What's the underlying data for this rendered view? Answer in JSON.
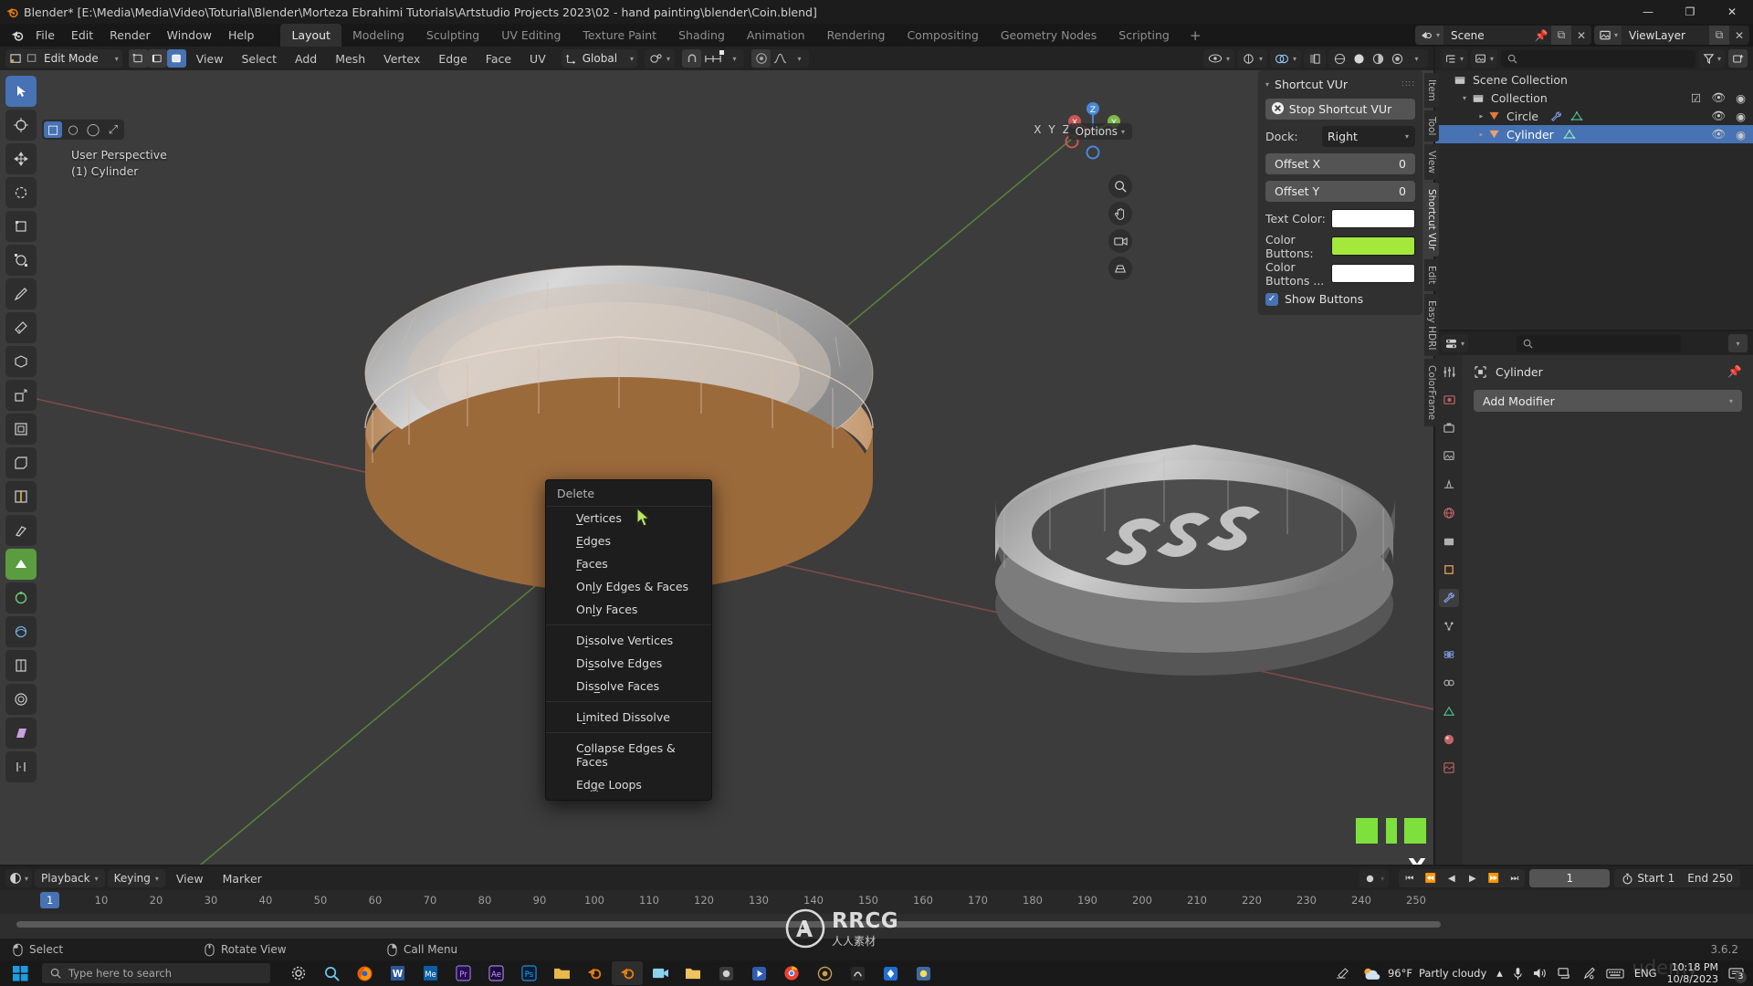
{
  "window": {
    "title": "Blender* [E:\\Media\\Media\\Video\\Toturial\\Blender\\Morteza Ebrahimi Tutorials\\Artstudio Projects 2023\\02 - hand painting\\blender\\Coin.blend]",
    "minimize": "—",
    "maximize": "❐",
    "close": "✕"
  },
  "topbar": {
    "menus": [
      "File",
      "Edit",
      "Render",
      "Window",
      "Help"
    ],
    "workspaces": [
      "Layout",
      "Modeling",
      "Sculpting",
      "UV Editing",
      "Texture Paint",
      "Shading",
      "Animation",
      "Rendering",
      "Compositing",
      "Geometry Nodes",
      "Scripting"
    ],
    "active_workspace": "Layout",
    "add_workspace": "+",
    "scene_name": "Scene",
    "viewlayer_name": "ViewLayer"
  },
  "viewport_header": {
    "mode": "Edit Mode",
    "menus": [
      "View",
      "Select",
      "Add",
      "Mesh",
      "Vertex",
      "Edge",
      "Face",
      "UV"
    ],
    "orientation": "Global",
    "options_label": "Options",
    "xyz": [
      "X",
      "Y",
      "Z"
    ]
  },
  "viewport": {
    "perspective": "User Perspective",
    "object_info": "(1) Cylinder"
  },
  "context_menu": {
    "title": "Delete",
    "groups": [
      [
        {
          "label": "Vertices",
          "accel_index": 0
        },
        {
          "label": "Edges",
          "accel_index": 0
        },
        {
          "label": "Faces",
          "accel_index": 0
        },
        {
          "label": "Only Edges & Faces",
          "accel_index": 2
        },
        {
          "label": "Only Faces",
          "accel_index": 2
        }
      ],
      [
        {
          "label": "Dissolve Vertices",
          "accel_index": 1
        },
        {
          "label": "Dissolve Edges",
          "accel_index": 2
        },
        {
          "label": "Dissolve Faces",
          "accel_index": 3
        }
      ],
      [
        {
          "label": "Limited Dissolve",
          "accel_index": 1
        }
      ],
      [
        {
          "label": "Collapse Edges & Faces",
          "accel_index": 1
        },
        {
          "label": "Edge Loops",
          "accel_index": 2
        }
      ]
    ]
  },
  "npanel": {
    "title": "Shortcut VUr",
    "stop_button": "Stop Shortcut VUr",
    "dock_label": "Dock:",
    "dock_value": "Right",
    "offset_x_label": "Offset X",
    "offset_x_value": "0",
    "offset_y_label": "Offset Y",
    "offset_y_value": "0",
    "text_color_label": "Text Color:",
    "text_color_value": "#ffffff",
    "color_buttons_label": "Color Buttons:",
    "color_buttons_value": "#a4e83c",
    "color_buttons2_label": "Color Buttons ...",
    "color_buttons2_value": "#ffffff",
    "show_buttons_label": "Show Buttons",
    "show_buttons_checked": true,
    "side_tabs": [
      "Item",
      "Tool",
      "View",
      "Shortcut VUr",
      "Edit",
      "Easy HDRI",
      "ColorFrame"
    ]
  },
  "outliner": {
    "search_placeholder": "",
    "rows": [
      {
        "label": "Scene Collection",
        "indent": 0,
        "icon": "collection-icon",
        "selected": false,
        "has_check": false,
        "has_eye": false
      },
      {
        "label": "Collection",
        "indent": 1,
        "icon": "collection-icon",
        "selected": false,
        "has_check": true,
        "has_eye": true
      },
      {
        "label": "Circle",
        "indent": 2,
        "icon": "mesh-data-icon",
        "selected": false,
        "has_check": false,
        "has_eye": true
      },
      {
        "label": "Cylinder",
        "indent": 2,
        "icon": "mesh-data-icon",
        "selected": true,
        "has_check": false,
        "has_eye": true
      }
    ]
  },
  "properties": {
    "object_name": "Cylinder",
    "add_modifier": "Add Modifier",
    "search_placeholder": ""
  },
  "timeline": {
    "playback": "Playback",
    "keying": "Keying",
    "view": "View",
    "marker": "Marker",
    "current_frame": "1",
    "start_label": "Start",
    "start_value": "1",
    "end_label": "End",
    "end_value": "250",
    "playhead_label": "1",
    "ticks": [
      10,
      20,
      30,
      40,
      50,
      60,
      70,
      80,
      90,
      100,
      110,
      120,
      130,
      140,
      150,
      160,
      170,
      180,
      190,
      200,
      210,
      220,
      230,
      240,
      250
    ]
  },
  "statusbar": {
    "items": [
      "Select",
      "Rotate View",
      "Call Menu"
    ],
    "version": "3.6.2"
  },
  "taskbar": {
    "search_placeholder": "Type here to search",
    "apps": [
      "gear-icon",
      "search-icon",
      "firefox-icon",
      "word-icon",
      "mail-icon",
      "premiere-icon",
      "aftereffects-icon",
      "photoshop-icon",
      "folder-icon",
      "blender-icon",
      "blender-active-icon",
      "camtasia-icon",
      "explorer-icon",
      "app-icon",
      "media-icon",
      "chrome-icon",
      "3dcoat-icon",
      "substance-icon",
      "unity-icon",
      "krita-icon"
    ],
    "weather_temp": "96°F",
    "weather_desc": "Partly cloudy",
    "language": "ENG",
    "time": "10:18 PM",
    "date": "10/8/2023",
    "notification_count": "3"
  },
  "watermark": {
    "text": "RRCG",
    "chinese": "人人素材",
    "udemy": "udemy"
  },
  "overlay": {
    "x_marker": "X"
  },
  "colors": {
    "accent_blue": "#4772b3",
    "green_button": "#a4e83c",
    "object_orange": "#9c6a3c",
    "viewport_bg": "#3c3c3c"
  }
}
